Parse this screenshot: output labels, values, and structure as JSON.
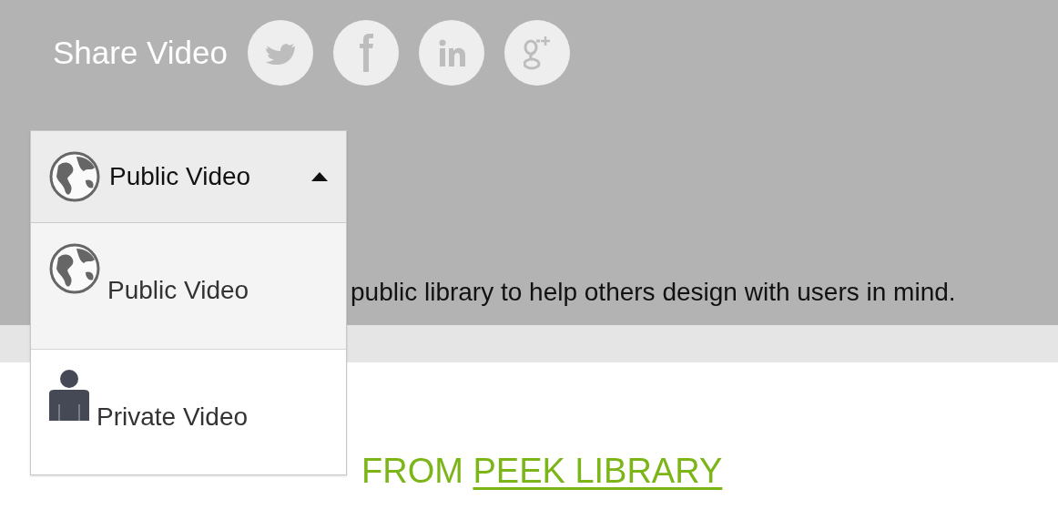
{
  "share": {
    "title": "Share Video",
    "buttons": [
      {
        "kind": "twitter"
      },
      {
        "kind": "facebook"
      },
      {
        "kind": "linkedin"
      },
      {
        "kind": "googleplus"
      }
    ]
  },
  "visibility_dropdown": {
    "value": "Public Video",
    "expanded": true,
    "options": [
      {
        "label": "Public Video",
        "kind": "public",
        "selected": true
      },
      {
        "label": "Private Video",
        "kind": "private",
        "selected": false
      }
    ]
  },
  "description": "public library to help others design with users in mind.",
  "related_heading": {
    "text": "FROM",
    "link": "PEEK LIBRARY"
  }
}
